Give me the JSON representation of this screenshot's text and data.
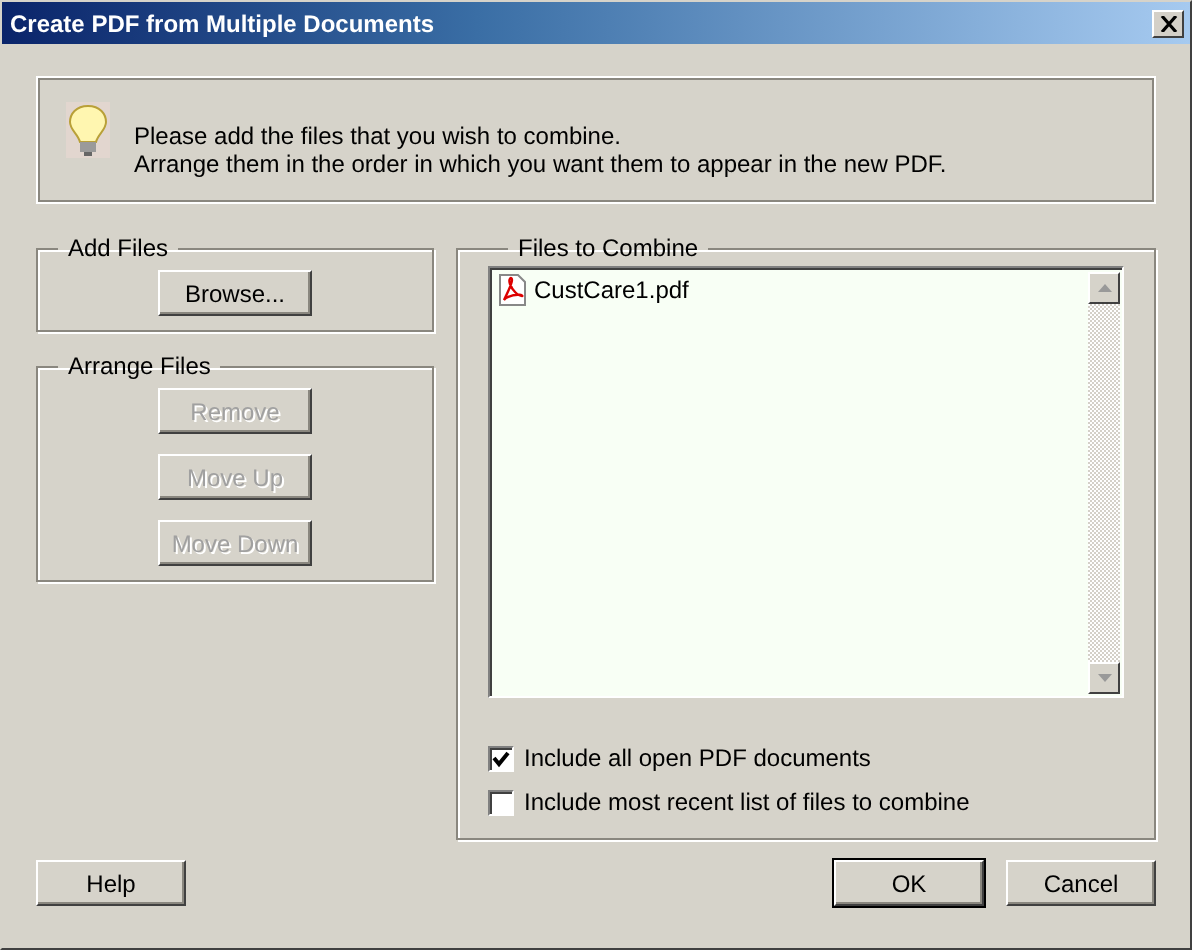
{
  "window": {
    "title": "Create PDF from Multiple Documents"
  },
  "info": {
    "lines": [
      "Please add the files that you wish to combine.",
      "Arrange them in the order in which you want them to appear in the new PDF."
    ]
  },
  "add_files": {
    "label": "Add Files",
    "buttons": [
      {
        "label": "Browse...",
        "disabled": false
      }
    ]
  },
  "arrange_files": {
    "label": "Arrange Files",
    "buttons": [
      {
        "label": "Remove",
        "disabled": true
      },
      {
        "label": "Move Up",
        "disabled": true
      },
      {
        "label": "Move Down",
        "disabled": true
      }
    ]
  },
  "files_to_combine": {
    "label": "Files to Combine",
    "files": [
      {
        "name": "CustCare1.pdf"
      }
    ],
    "options": [
      {
        "label": "Include all open PDF documents",
        "checked": true
      },
      {
        "label": "Include most recent list of files to combine",
        "checked": false
      }
    ]
  },
  "footer_buttons": [
    {
      "label": "Help",
      "default": false
    },
    {
      "label": "OK",
      "default": true
    },
    {
      "label": "Cancel",
      "default": false
    }
  ]
}
